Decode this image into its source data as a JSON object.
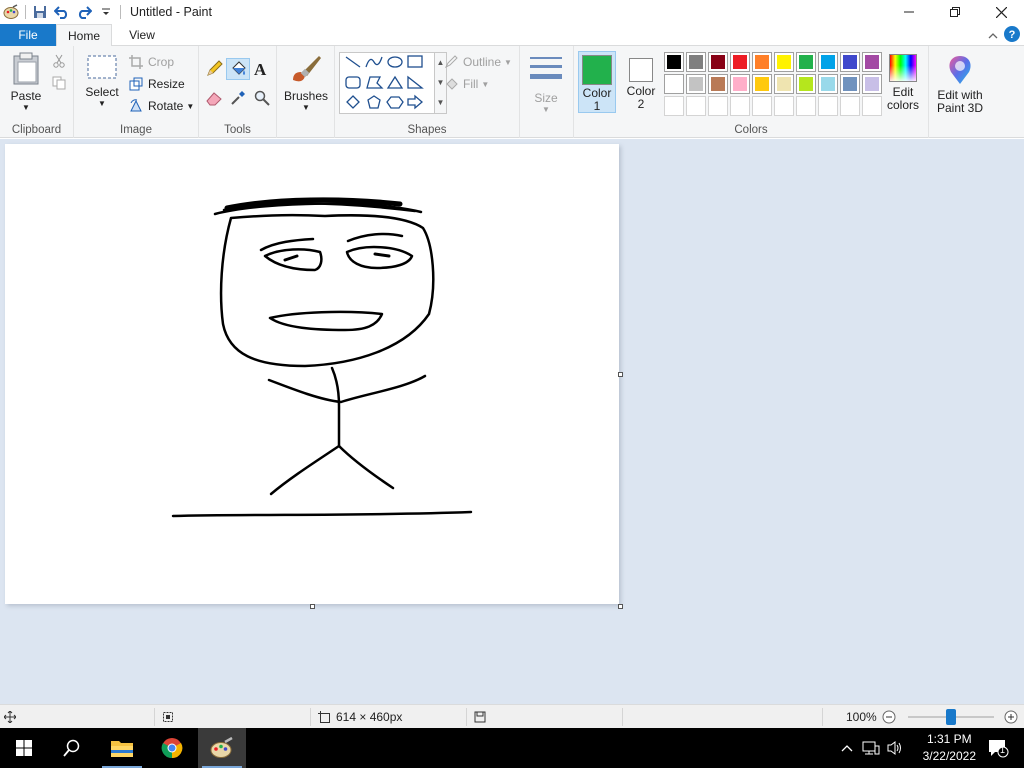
{
  "window": {
    "title": "Untitled - Paint"
  },
  "tabs": {
    "file": "File",
    "home": "Home",
    "view": "View"
  },
  "ribbon": {
    "clipboard": {
      "paste": "Paste",
      "label": "Clipboard"
    },
    "image": {
      "select": "Select",
      "crop": "Crop",
      "resize": "Resize",
      "rotate": "Rotate",
      "label": "Image"
    },
    "tools": {
      "label": "Tools"
    },
    "brushes": {
      "label": "Brushes"
    },
    "shapes": {
      "outline": "Outline",
      "fill": "Fill",
      "label": "Shapes"
    },
    "size": {
      "label": "Size"
    },
    "colors": {
      "color1": "Color",
      "color1_num": "1",
      "color2": "Color",
      "color2_num": "2",
      "edit_colors": "Edit colors",
      "label": "Colors",
      "color1_value": "#22b14c",
      "color2_value": "#ffffff",
      "palette": [
        "#000000",
        "#7f7f7f",
        "#880015",
        "#ed1c24",
        "#ff7f27",
        "#fff200",
        "#22b14c",
        "#00a2e8",
        "#3f48cc",
        "#a349a4",
        "#ffffff",
        "#c3c3c3",
        "#b97a57",
        "#ffaec9",
        "#ffc90e",
        "#efe4b0",
        "#b5e61d",
        "#99d9ea",
        "#7092be",
        "#c8bfe7",
        "",
        "",
        "",
        "",
        "",
        "",
        "",
        "",
        "",
        ""
      ]
    },
    "paint3d": {
      "label": "Edit with Paint 3D"
    }
  },
  "status": {
    "canvas_size": "614 × 460px",
    "zoom": "100%",
    "zoom_level": 0.5
  },
  "taskbar": {
    "time": "1:31 PM",
    "date": "3/22/2022",
    "notification_count": "1"
  }
}
